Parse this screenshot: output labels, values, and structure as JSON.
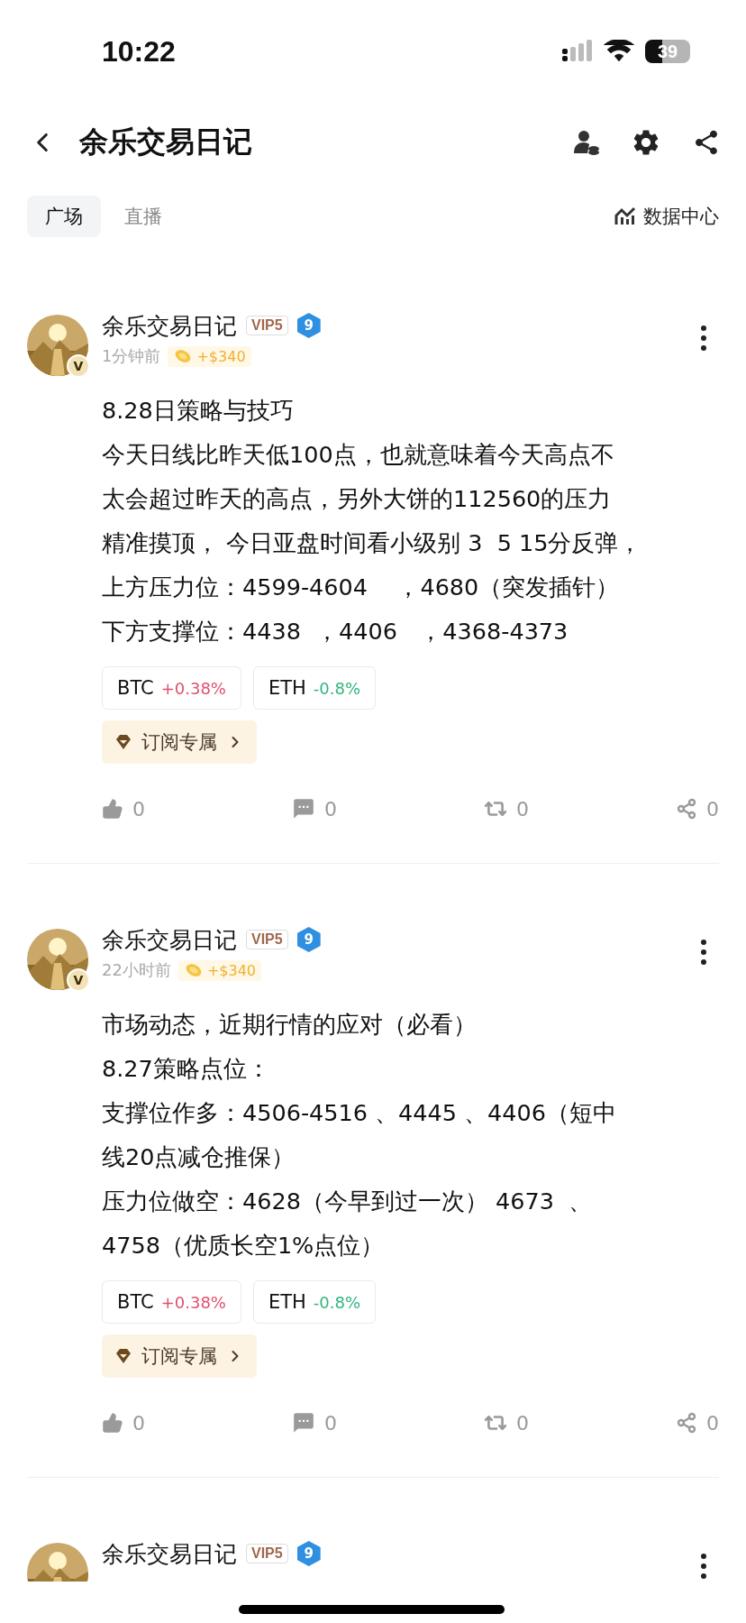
{
  "status_bar": {
    "time": "10:22",
    "battery": "39"
  },
  "nav": {
    "title": "余乐交易日记"
  },
  "tabs": [
    {
      "label": "广场",
      "selected": true
    },
    {
      "label": "直播",
      "selected": false
    }
  ],
  "data_center": "数据中心",
  "posts": [
    {
      "author": "余乐交易日记",
      "badge": "V",
      "vip": "VIP5",
      "level": "9",
      "time": "1分钟前",
      "reward": "+$340",
      "lines": [
        "8.28日策略与技巧",
        "今天日线比昨天低100点，也就意味着今天高点不",
        "太会超过昨天的高点，另外大饼的112560的压力",
        "精准摸顶， 今日亚盘时间看小级别 3  5 15分反弹，",
        "上方压力位：4599-4604    ，4680（突发插针）",
        "下方支撑位：4438  ，4406   ，4368-4373"
      ],
      "tickers": [
        {
          "symbol": "BTC",
          "change": "+0.38%",
          "color": "#e0506e"
        },
        {
          "symbol": "ETH",
          "change": "-0.8%",
          "color": "#2fb57e"
        }
      ],
      "subscribe": "订阅专属",
      "likes": "0",
      "comments": "0",
      "reposts": "0",
      "shares": "0"
    },
    {
      "author": "余乐交易日记",
      "badge": "V",
      "vip": "VIP5",
      "level": "9",
      "time": "22小时前",
      "reward": "+$340",
      "lines": [
        "市场动态，近期行情的应对（必看）",
        "8.27策略点位：",
        "支撑位作多：4506-4516 、4445 、4406（短中",
        "线20点减仓推保）",
        "压力位做空：4628（今早到过一次） 4673  、",
        "4758（优质长空1%点位）"
      ],
      "tickers": [
        {
          "symbol": "BTC",
          "change": "+0.38%",
          "color": "#e0506e"
        },
        {
          "symbol": "ETH",
          "change": "-0.8%",
          "color": "#2fb57e"
        }
      ],
      "subscribe": "订阅专属",
      "likes": "0",
      "comments": "0",
      "reposts": "0",
      "shares": "0"
    },
    {
      "author": "余乐交易日记",
      "vip": "VIP5",
      "level": "9"
    }
  ]
}
